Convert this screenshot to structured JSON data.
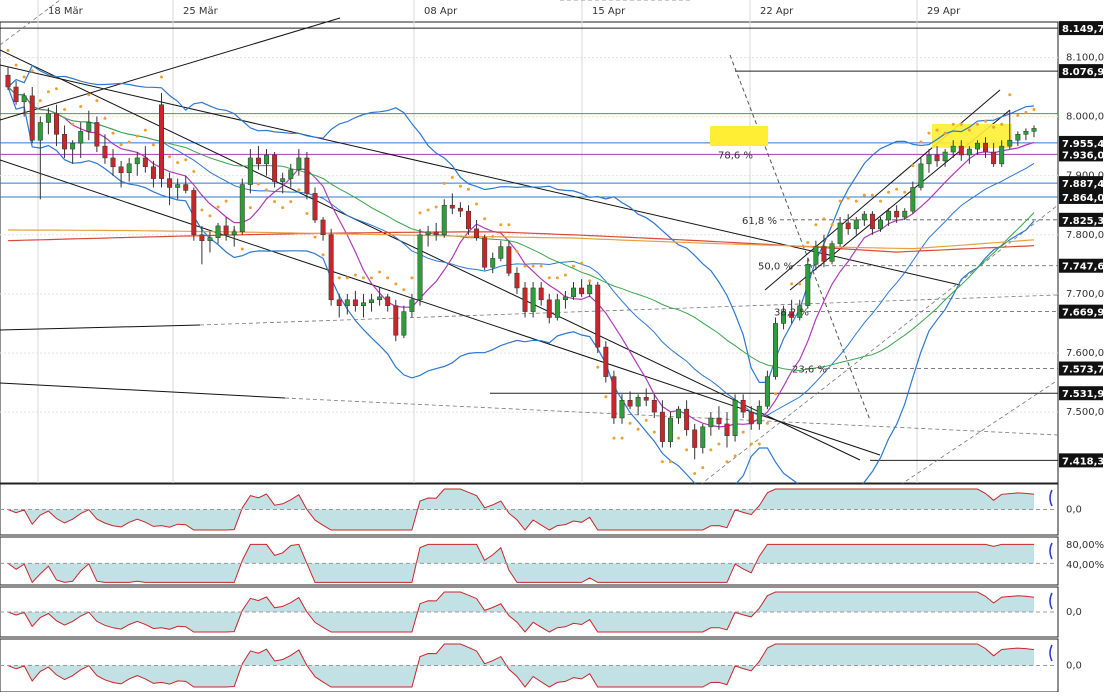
{
  "chart_data": {
    "type": "candlestick",
    "x_axis": {
      "tick_labels": [
        "18 Mär",
        "25 Mär",
        "08 Apr",
        "15 Apr",
        "22 Apr",
        "29 Apr"
      ]
    },
    "y_axis": {
      "ylim": [
        7380,
        8160
      ],
      "tick_labels": [
        {
          "value": 8100,
          "label": "8.100,0"
        },
        {
          "value": 8000,
          "label": "8.000,0"
        },
        {
          "value": 7900,
          "label": "7.900,0"
        },
        {
          "value": 7800,
          "label": "7.800,0"
        },
        {
          "value": 7700,
          "label": "7.700,0"
        },
        {
          "value": 7600,
          "label": "7.600,0"
        },
        {
          "value": 7500,
          "label": "7.500,0"
        }
      ]
    },
    "price_tags": [
      {
        "value": 8149.7,
        "label": "8.149,7"
      },
      {
        "value": 8076.9,
        "label": "8.076,9"
      },
      {
        "value": 7955.4,
        "label": "7.955,4"
      },
      {
        "value": 7936.0,
        "label": "7.936,0"
      },
      {
        "value": 7887.4,
        "label": "7.887,4"
      },
      {
        "value": 7864.0,
        "label": "7.864,0"
      },
      {
        "value": 7825.3,
        "label": "7.825,3"
      },
      {
        "value": 7747.6,
        "label": "7.747,6"
      },
      {
        "value": 7669.9,
        "label": "7.669,9"
      },
      {
        "value": 7573.7,
        "label": "7.573,7"
      },
      {
        "value": 7531.9,
        "label": "7.531,9"
      },
      {
        "value": 7418.3,
        "label": "7.418,3"
      }
    ],
    "fib_labels": [
      {
        "value": 7936.0,
        "label": "78,6 %"
      },
      {
        "value": 7825.3,
        "label": "61,8 %"
      },
      {
        "value": 7747.6,
        "label": "50,0 %"
      },
      {
        "value": 7669.9,
        "label": "38,2 %"
      },
      {
        "value": 7573.7,
        "label": "23,6 %"
      }
    ],
    "candles_ohlc": [
      [
        8070,
        8085,
        8045,
        8050
      ],
      [
        8050,
        8060,
        8020,
        8025
      ],
      [
        8025,
        8040,
        8000,
        8035
      ],
      [
        8035,
        8050,
        7955,
        7960
      ],
      [
        7960,
        8000,
        7860,
        7990
      ],
      [
        7990,
        8015,
        7970,
        8005
      ],
      [
        8005,
        8020,
        7950,
        7970
      ],
      [
        7970,
        7985,
        7930,
        7945
      ],
      [
        7945,
        7960,
        7920,
        7955
      ],
      [
        7955,
        7990,
        7930,
        7975
      ],
      [
        7975,
        8010,
        7960,
        7990
      ],
      [
        7990,
        8000,
        7940,
        7950
      ],
      [
        7950,
        7970,
        7920,
        7930
      ],
      [
        7930,
        7945,
        7900,
        7915
      ],
      [
        7915,
        7925,
        7880,
        7905
      ],
      [
        7905,
        7930,
        7890,
        7920
      ],
      [
        7920,
        7940,
        7900,
        7930
      ],
      [
        7930,
        7950,
        7905,
        7915
      ],
      [
        7915,
        7925,
        7880,
        7895
      ],
      [
        8020,
        8040,
        7880,
        7895
      ],
      [
        7895,
        7905,
        7850,
        7880
      ],
      [
        7880,
        7895,
        7860,
        7885
      ],
      [
        7885,
        7900,
        7870,
        7875
      ],
      [
        7875,
        7880,
        7790,
        7800
      ],
      [
        7800,
        7815,
        7750,
        7790
      ],
      [
        7790,
        7805,
        7770,
        7795
      ],
      [
        7795,
        7820,
        7785,
        7815
      ],
      [
        7815,
        7830,
        7790,
        7800
      ],
      [
        7800,
        7815,
        7780,
        7805
      ],
      [
        7805,
        7895,
        7800,
        7885
      ],
      [
        7885,
        7945,
        7870,
        7930
      ],
      [
        7930,
        7950,
        7910,
        7920
      ],
      [
        7920,
        7945,
        7900,
        7935
      ],
      [
        7935,
        7940,
        7880,
        7890
      ],
      [
        7890,
        7905,
        7870,
        7895
      ],
      [
        7895,
        7920,
        7880,
        7910
      ],
      [
        7910,
        7945,
        7900,
        7930
      ],
      [
        7930,
        7940,
        7860,
        7870
      ],
      [
        7870,
        7880,
        7820,
        7825
      ],
      [
        7825,
        7830,
        7790,
        7800
      ],
      [
        7800,
        7810,
        7680,
        7690
      ],
      [
        7690,
        7700,
        7660,
        7680
      ],
      [
        7680,
        7700,
        7665,
        7690
      ],
      [
        7690,
        7705,
        7670,
        7680
      ],
      [
        7680,
        7700,
        7660,
        7685
      ],
      [
        7685,
        7700,
        7670,
        7690
      ],
      [
        7690,
        7710,
        7680,
        7695
      ],
      [
        7695,
        7700,
        7670,
        7680
      ],
      [
        7680,
        7690,
        7620,
        7630
      ],
      [
        7630,
        7680,
        7625,
        7670
      ],
      [
        7670,
        7700,
        7660,
        7690
      ],
      [
        7690,
        7810,
        7680,
        7800
      ],
      [
        7800,
        7815,
        7780,
        7805
      ],
      [
        7805,
        7820,
        7790,
        7800
      ],
      [
        7800,
        7860,
        7795,
        7850
      ],
      [
        7850,
        7870,
        7835,
        7845
      ],
      [
        7845,
        7855,
        7830,
        7840
      ],
      [
        7840,
        7850,
        7800,
        7810
      ],
      [
        7810,
        7825,
        7790,
        7795
      ],
      [
        7795,
        7800,
        7740,
        7745
      ],
      [
        7745,
        7770,
        7735,
        7760
      ],
      [
        7760,
        7790,
        7755,
        7780
      ],
      [
        7780,
        7790,
        7730,
        7735
      ],
      [
        7735,
        7745,
        7700,
        7710
      ],
      [
        7710,
        7720,
        7660,
        7670
      ],
      [
        7670,
        7720,
        7660,
        7710
      ],
      [
        7710,
        7720,
        7680,
        7690
      ],
      [
        7690,
        7700,
        7650,
        7660
      ],
      [
        7660,
        7700,
        7655,
        7690
      ],
      [
        7690,
        7705,
        7675,
        7695
      ],
      [
        7695,
        7720,
        7690,
        7710
      ],
      [
        7710,
        7725,
        7695,
        7700
      ],
      [
        7700,
        7720,
        7695,
        7715
      ],
      [
        7715,
        7720,
        7600,
        7610
      ],
      [
        7610,
        7620,
        7550,
        7560
      ],
      [
        7560,
        7570,
        7480,
        7490
      ],
      [
        7490,
        7530,
        7480,
        7520
      ],
      [
        7520,
        7535,
        7505,
        7510
      ],
      [
        7510,
        7530,
        7495,
        7525
      ],
      [
        7525,
        7540,
        7510,
        7520
      ],
      [
        7520,
        7530,
        7490,
        7500
      ],
      [
        7500,
        7520,
        7440,
        7450
      ],
      [
        7450,
        7500,
        7440,
        7490
      ],
      [
        7490,
        7510,
        7480,
        7505
      ],
      [
        7505,
        7520,
        7460,
        7470
      ],
      [
        7470,
        7480,
        7420,
        7440
      ],
      [
        7440,
        7480,
        7430,
        7475
      ],
      [
        7475,
        7500,
        7460,
        7490
      ],
      [
        7490,
        7510,
        7470,
        7480
      ],
      [
        7480,
        7500,
        7440,
        7460
      ],
      [
        7460,
        7530,
        7450,
        7520
      ],
      [
        7520,
        7530,
        7490,
        7500
      ],
      [
        7500,
        7510,
        7470,
        7480
      ],
      [
        7480,
        7520,
        7470,
        7510
      ],
      [
        7510,
        7570,
        7505,
        7560
      ],
      [
        7560,
        7660,
        7555,
        7650
      ],
      [
        7650,
        7680,
        7640,
        7670
      ],
      [
        7670,
        7690,
        7650,
        7660
      ],
      [
        7660,
        7690,
        7655,
        7680
      ],
      [
        7680,
        7760,
        7675,
        7750
      ],
      [
        7750,
        7790,
        7740,
        7780
      ],
      [
        7780,
        7800,
        7745,
        7755
      ],
      [
        7755,
        7790,
        7750,
        7785
      ],
      [
        7785,
        7830,
        7780,
        7820
      ],
      [
        7820,
        7835,
        7800,
        7810
      ],
      [
        7810,
        7830,
        7800,
        7825
      ],
      [
        7825,
        7840,
        7815,
        7835
      ],
      [
        7835,
        7840,
        7800,
        7810
      ],
      [
        7810,
        7830,
        7805,
        7825
      ],
      [
        7825,
        7845,
        7815,
        7840
      ],
      [
        7840,
        7850,
        7820,
        7830
      ],
      [
        7830,
        7845,
        7825,
        7840
      ],
      [
        7840,
        7890,
        7835,
        7880
      ],
      [
        7880,
        7930,
        7875,
        7920
      ],
      [
        7920,
        7945,
        7905,
        7935
      ],
      [
        7935,
        7950,
        7915,
        7925
      ],
      [
        7925,
        7945,
        7915,
        7940
      ],
      [
        7940,
        7960,
        7930,
        7950
      ],
      [
        7950,
        7960,
        7925,
        7935
      ],
      [
        7935,
        7950,
        7920,
        7945
      ],
      [
        7945,
        7960,
        7935,
        7955
      ],
      [
        7955,
        7965,
        7930,
        7940
      ],
      [
        7940,
        7955,
        7915,
        7920
      ],
      [
        7920,
        7960,
        7915,
        7950
      ],
      [
        7950,
        8010,
        7945,
        7960
      ],
      [
        7960,
        7975,
        7950,
        7970
      ],
      [
        7970,
        7980,
        7960,
        7975
      ],
      [
        7975,
        7985,
        7965,
        7980
      ]
    ],
    "lower_panels": [
      {
        "name": "",
        "tick_labels": [
          "0,0"
        ]
      },
      {
        "name": "",
        "tick_labels": [
          "80,00%",
          "40,00%"
        ]
      },
      {
        "name": "",
        "tick_labels": [
          "0,0"
        ]
      },
      {
        "name": "",
        "tick_labels": [
          "0,0"
        ]
      }
    ],
    "grid": true,
    "colors": {
      "up": "#2e9e3a",
      "down": "#c8262a",
      "bollinger": "#2d78d0",
      "sma_short": "#b03ab8",
      "sma_mid": "#3aa64a",
      "sma_long": "#d84a3a",
      "sma_long2": "#e8a040",
      "psar": "#f0a030",
      "highlight": "#ffee33",
      "osc_fill": "#c87070",
      "osc_fill_pos": "#8fc8d0"
    }
  }
}
